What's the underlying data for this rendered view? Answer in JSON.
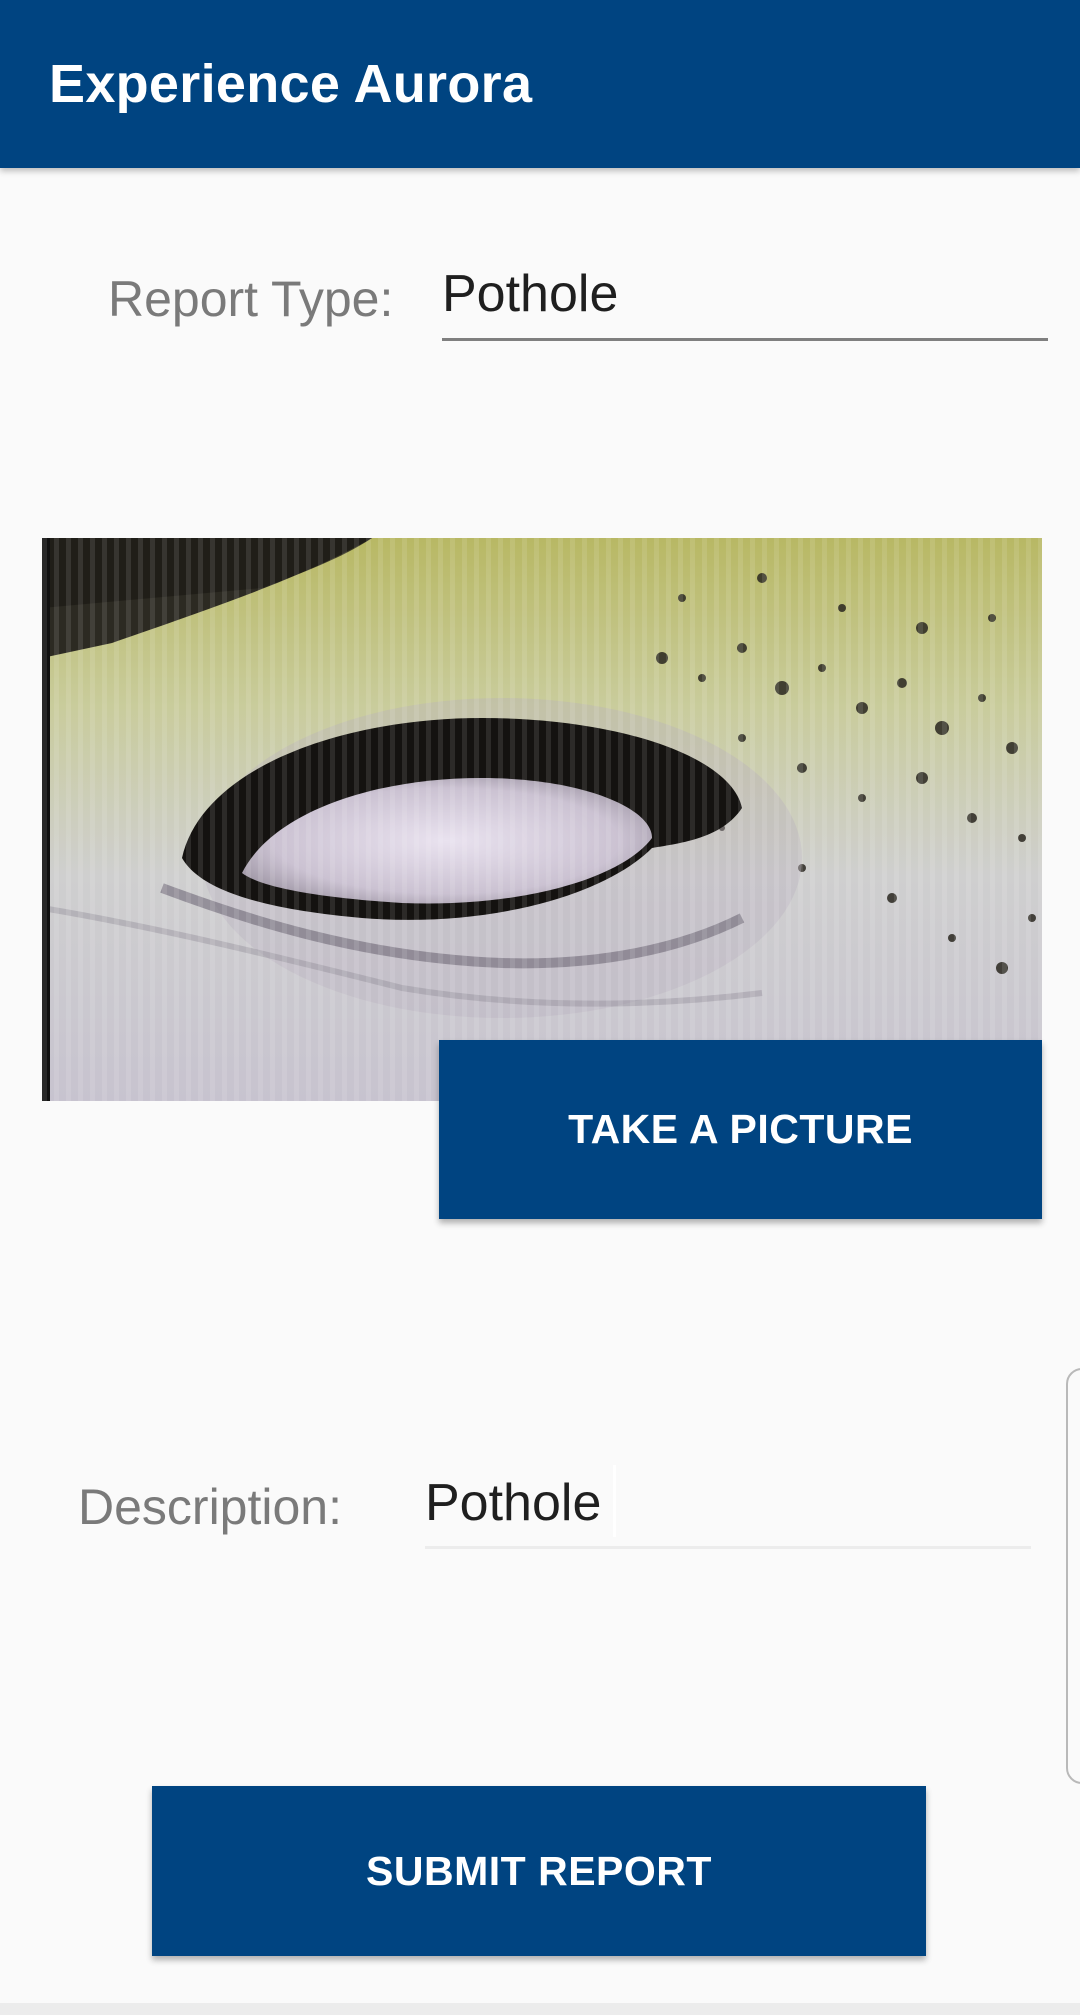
{
  "app_bar": {
    "title": "Experience Aurora"
  },
  "form": {
    "report_type_label": "Report Type:",
    "report_type_value": "Pothole",
    "description_label": "Description:",
    "description_value": "Pothole"
  },
  "photo": {
    "subject": "pothole-photo"
  },
  "buttons": {
    "take_picture": "TAKE A PICTURE",
    "submit": "SUBMIT REPORT"
  },
  "colors": {
    "primary": "#004481",
    "background": "#fafafa",
    "label": "#7a7a7a"
  }
}
